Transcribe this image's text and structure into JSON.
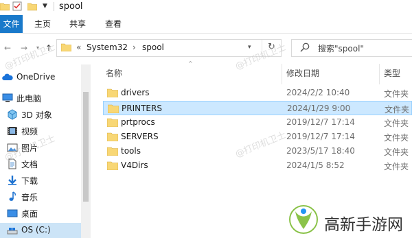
{
  "window": {
    "title": "spool"
  },
  "ribbon": {
    "tabs": [
      "文件",
      "主页",
      "共享",
      "查看"
    ]
  },
  "address": {
    "crumbs": [
      "System32",
      "spool"
    ],
    "overflow": "«"
  },
  "search": {
    "placeholder": "搜索\"spool\""
  },
  "sidebar": {
    "items": [
      {
        "label": "OneDrive",
        "icon": "onedrive-icon"
      },
      {
        "label": "此电脑",
        "icon": "computer-icon"
      },
      {
        "label": "3D 对象",
        "icon": "3d-objects-icon"
      },
      {
        "label": "视频",
        "icon": "video-icon"
      },
      {
        "label": "图片",
        "icon": "pictures-icon"
      },
      {
        "label": "文档",
        "icon": "documents-icon"
      },
      {
        "label": "下载",
        "icon": "download-icon"
      },
      {
        "label": "音乐",
        "icon": "music-icon"
      },
      {
        "label": "桌面",
        "icon": "desktop-icon"
      },
      {
        "label": "OS (C:)",
        "icon": "drive-icon",
        "selected": true
      }
    ]
  },
  "columns": {
    "name": "名称",
    "date": "修改日期",
    "type": "类型"
  },
  "files": [
    {
      "name": "drivers",
      "date": "2024/2/2 10:40",
      "type": "文件夹"
    },
    {
      "name": "PRINTERS",
      "date": "2024/1/29 9:00",
      "type": "文件夹",
      "selected": true
    },
    {
      "name": "prtprocs",
      "date": "2019/12/7 17:14",
      "type": "文件夹"
    },
    {
      "name": "SERVERS",
      "date": "2019/12/7 17:14",
      "type": "文件夹"
    },
    {
      "name": "tools",
      "date": "2023/5/17 18:40",
      "type": "文件夹"
    },
    {
      "name": "V4Dirs",
      "date": "2024/1/5 8:52",
      "type": "文件夹"
    }
  ],
  "watermark": {
    "text": "@打印机卫士"
  },
  "brand": {
    "text": "高新手游网"
  },
  "colors": {
    "accent": "#1979ca",
    "folder": "#f8d775",
    "selection": "#cce8ff"
  }
}
